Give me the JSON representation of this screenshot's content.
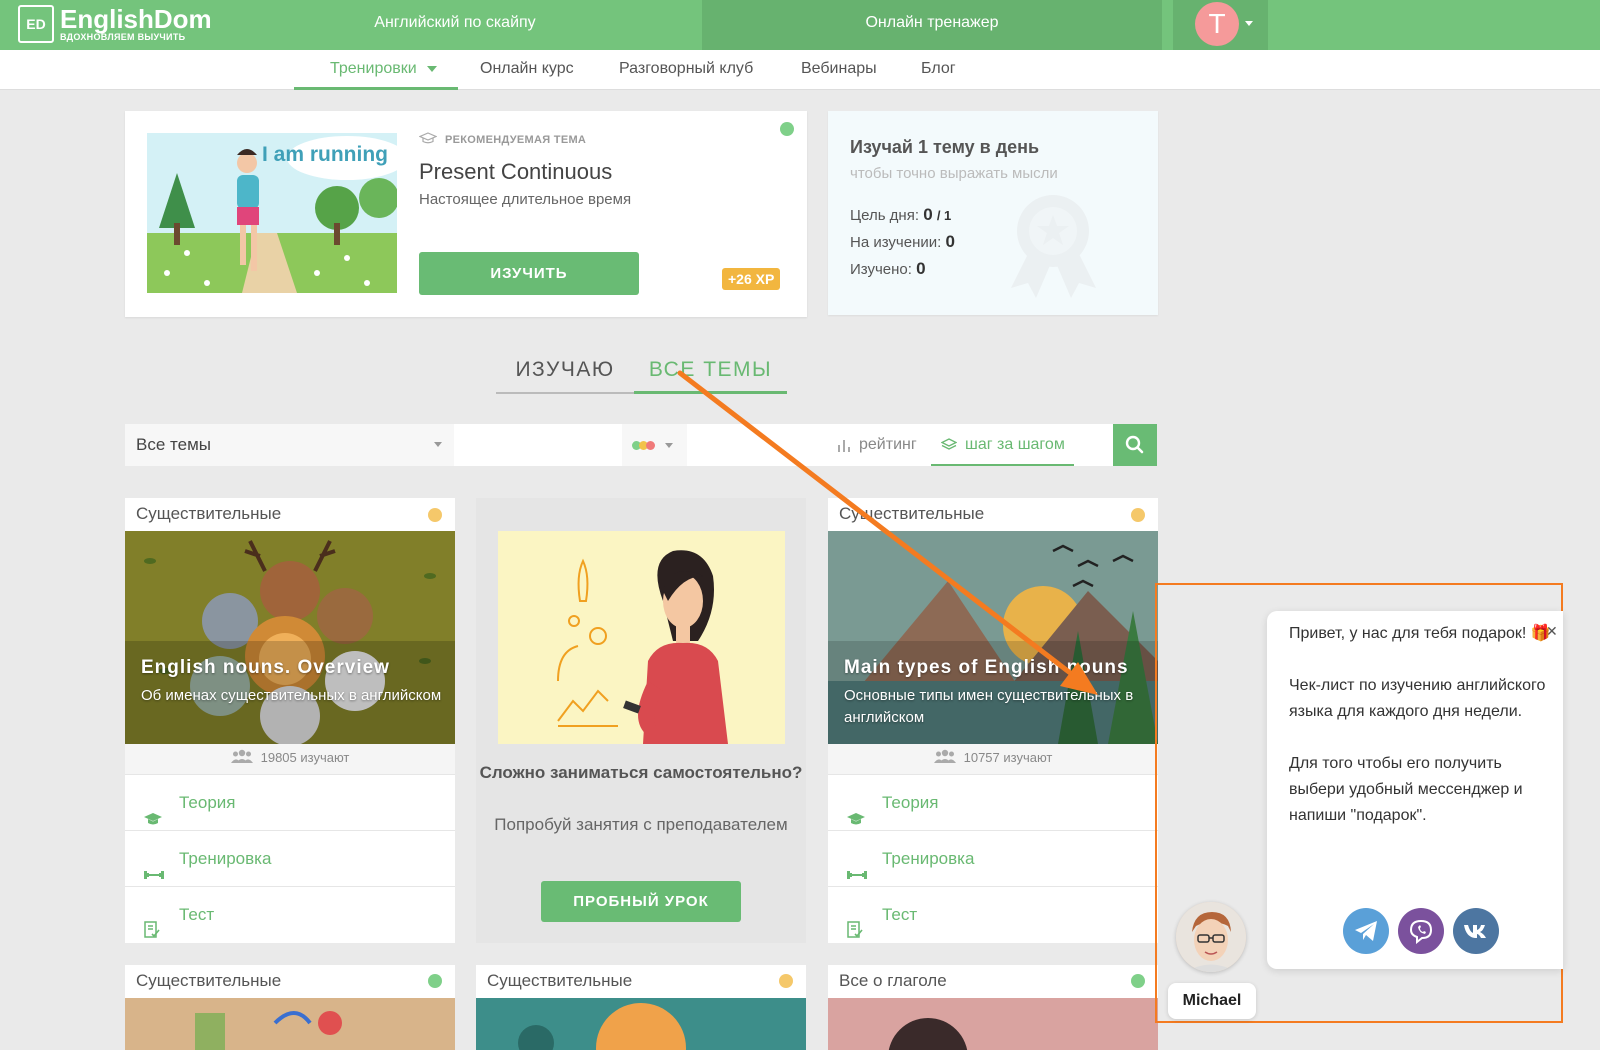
{
  "header": {
    "logo_abbr": "ED",
    "logo_title": "EnglishDom",
    "logo_tagline": "ВДОХНОВЛЯЕМ ВЫУЧИТЬ",
    "links": [
      "Английский по скайпу",
      "Онлайн тренажер"
    ],
    "active_link": "Онлайн тренажер",
    "avatar_letter": "T"
  },
  "subnav": {
    "items": [
      "Тренировки",
      "Онлайн курс",
      "Разговорный клуб",
      "Вебинары",
      "Блог"
    ],
    "active": "Тренировки"
  },
  "featured": {
    "image_caption": "I am running",
    "label": "РЕКОМЕНДУЕМАЯ ТЕМА",
    "title": "Present Continuous",
    "subtitle": "Настоящее длительное время",
    "button": "ИЗУЧИТЬ",
    "xp": "+26 XP",
    "status_color": "#7fd089"
  },
  "goal": {
    "title": "Изучай 1 тему в день",
    "subtitle": "чтобы точно выражать мысли",
    "day_goal_label": "Цель дня:",
    "day_goal_value": "0",
    "day_goal_total": "/ 1",
    "studying_label": "На изучении:",
    "studying_value": "0",
    "learned_label": "Изучено:",
    "learned_value": "0"
  },
  "tabs": [
    "ИЗУЧАЮ",
    "ВСЕ ТЕМЫ"
  ],
  "active_tab": "ВСЕ ТЕМЫ",
  "filter": {
    "category": "Все темы",
    "search_value": "",
    "sort_rating": "рейтинг",
    "sort_step": "шаг за шагом",
    "level_colors": [
      "#7fd089",
      "#f2c34a",
      "#f07a7a"
    ]
  },
  "cards": [
    {
      "category": "Существительные",
      "title": "English nouns. Overview",
      "description": "Об именах существительных в английском",
      "learners": "19805 изучают",
      "status_color": "#f5c86a",
      "rows": [
        "Теория",
        "Тренировка",
        "Тест"
      ]
    },
    {
      "category": "Существительные",
      "title": "Main types of English nouns",
      "description": "Основные типы имен существительных в английском",
      "learners": "10757 изучают",
      "status_color": "#f5c86a",
      "rows": [
        "Теория",
        "Тренировка",
        "Тест"
      ]
    }
  ],
  "promo": {
    "title": "Сложно заниматься самостоятельно?",
    "subtitle": "Попробуй занятия с преподавателем",
    "button": "ПРОБНЫЙ УРОК"
  },
  "bottom_cards": [
    {
      "category": "Существительные",
      "status_color": "#7fd089"
    },
    {
      "category": "Существительные",
      "status_color": "#f5c86a"
    },
    {
      "category": "Все о глаголе",
      "status_color": "#7fd089"
    }
  ],
  "chat": {
    "greeting": "Привет, у нас для тебя подарок! 🎁",
    "paragraph2": "Чек-лист по изучению английского языка для каждого дня недели.",
    "paragraph3": "Для того чтобы его получить выбери удобный мессенджер и напиши \"подарок\".",
    "messengers": [
      "telegram",
      "viber",
      "vk"
    ],
    "agent_name": "Michael"
  }
}
